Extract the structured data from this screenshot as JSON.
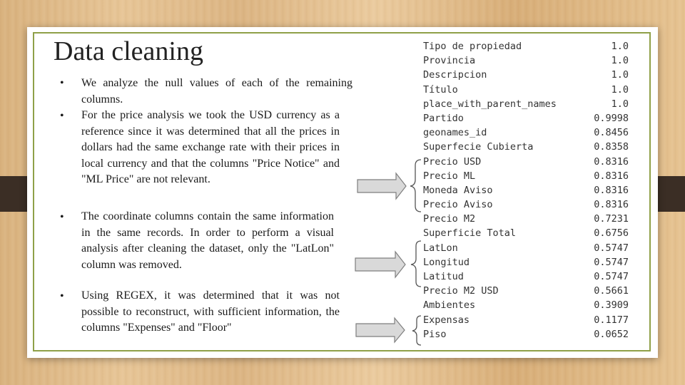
{
  "slide": {
    "title": "Data cleaning",
    "bullets": [
      "We analyze the null values of each of the remaining columns.",
      "For the price analysis we took the USD currency as a reference since it was determined that all the prices in dollars had the same exchange rate with their prices in local currency and that the columns \"Price Notice\" and \"ML Price\" are not relevant.",
      "The coordinate columns contain the same information in the same records. In order to perform a visual analysis after cleaning the dataset, only the \"LatLon\" column was removed.",
      "Using REGEX, it was determined that it was not possible to reconstruct, with sufficient information, the columns \"Expenses\" and \"Floor\""
    ],
    "bullet_glyph": "•"
  },
  "null_table": [
    {
      "column": "Tipo de propiedad",
      "value": "1.0"
    },
    {
      "column": "Provincia",
      "value": "1.0"
    },
    {
      "column": "Descripcion",
      "value": "1.0"
    },
    {
      "column": "Título",
      "value": "1.0"
    },
    {
      "column": "place_with_parent_names",
      "value": "1.0"
    },
    {
      "column": "Partido",
      "value": "0.9998"
    },
    {
      "column": "geonames_id",
      "value": "0.8456"
    },
    {
      "column": "Superfecie Cubierta",
      "value": "0.8358"
    },
    {
      "column": "Precio USD",
      "value": "0.8316"
    },
    {
      "column": "Precio ML",
      "value": "0.8316"
    },
    {
      "column": "Moneda Aviso",
      "value": "0.8316"
    },
    {
      "column": "Precio Aviso",
      "value": "0.8316"
    },
    {
      "column": "Precio M2",
      "value": "0.7231"
    },
    {
      "column": "Superficie Total",
      "value": "0.6756"
    },
    {
      "column": "LatLon",
      "value": "0.5747"
    },
    {
      "column": "Longitud",
      "value": "0.5747"
    },
    {
      "column": "Latitud",
      "value": "0.5747"
    },
    {
      "column": "Precio M2 USD",
      "value": "0.5661"
    },
    {
      "column": "Ambientes",
      "value": "0.3909"
    },
    {
      "column": "Expensas",
      "value": "0.1177"
    },
    {
      "column": "Piso",
      "value": "0.0652"
    }
  ],
  "colors": {
    "frame": "#8fa048",
    "arrow_fill": "#d9d9d9",
    "arrow_stroke": "#7f7f7f",
    "tab": "#3b2e25"
  }
}
